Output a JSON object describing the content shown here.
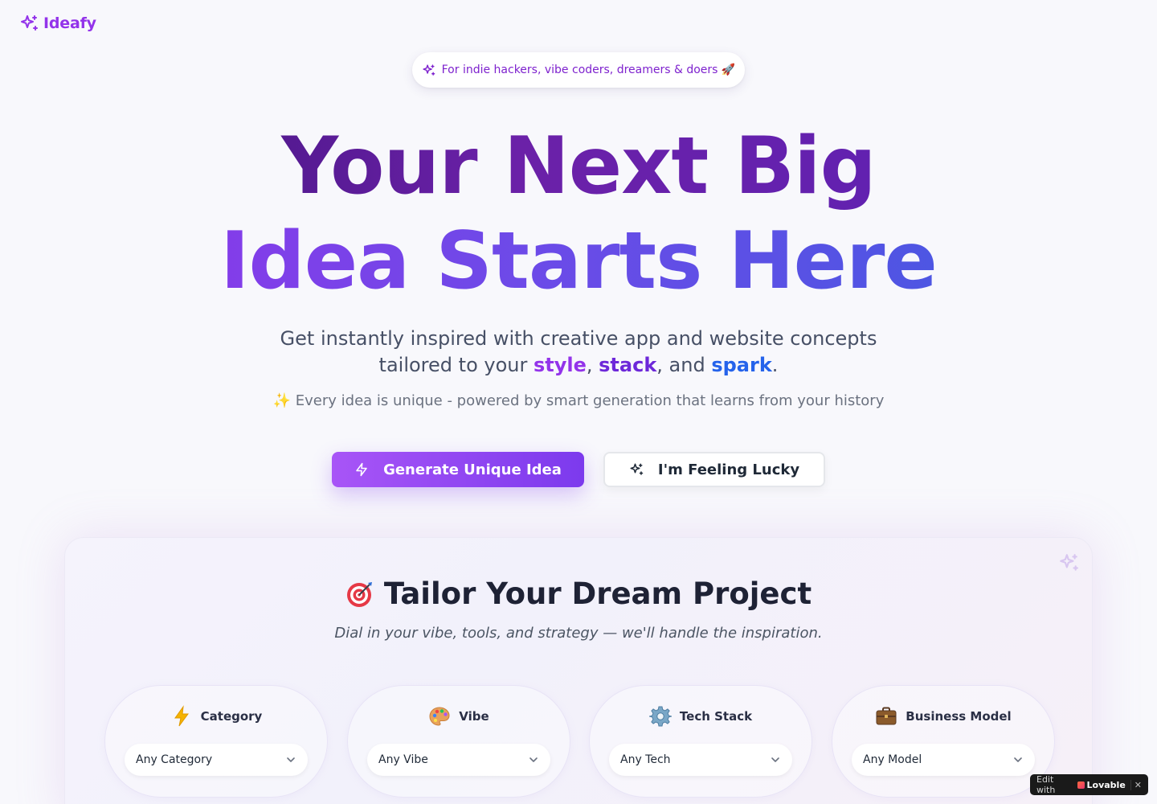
{
  "app": {
    "name": "Ideafy"
  },
  "hero": {
    "badge": "For indie hackers, vibe coders, dreamers & doers 🚀",
    "headline_line1": "Your Next Big",
    "headline_line2": "Idea Starts Here",
    "sub_part1": "Get instantly inspired with creative app and website concepts",
    "sub_part2": "tailored to your ",
    "sub_kw1": "style",
    "sub_sep1": ", ",
    "sub_kw2": "stack",
    "sub_sep2": ", and ",
    "sub_kw3": "spark",
    "sub_end": ".",
    "note": "✨ Every idea is unique - powered by smart generation that learns from your history",
    "primary_button": "Generate Unique Idea",
    "secondary_button": "I'm Feeling Lucky"
  },
  "tailor": {
    "title": "Tailor Your Dream Project",
    "subtitle": "Dial in your vibe, tools, and strategy — we'll handle the inspiration.",
    "filters": [
      {
        "label": "Category",
        "icon": "lightning-icon",
        "selected": "Any Category"
      },
      {
        "label": "Vibe",
        "icon": "palette-icon",
        "selected": "Any Vibe"
      },
      {
        "label": "Tech Stack",
        "icon": "gear-icon",
        "selected": "Any Tech"
      },
      {
        "label": "Business Model",
        "icon": "briefcase-icon",
        "selected": "Any Model"
      }
    ]
  },
  "lovable": {
    "edit_with": "Edit with",
    "brand": "Lovable",
    "close": "✕"
  },
  "colors": {
    "brand_purple": "#9333ea",
    "deep_purple": "#4c1d95",
    "blue": "#2563eb"
  }
}
